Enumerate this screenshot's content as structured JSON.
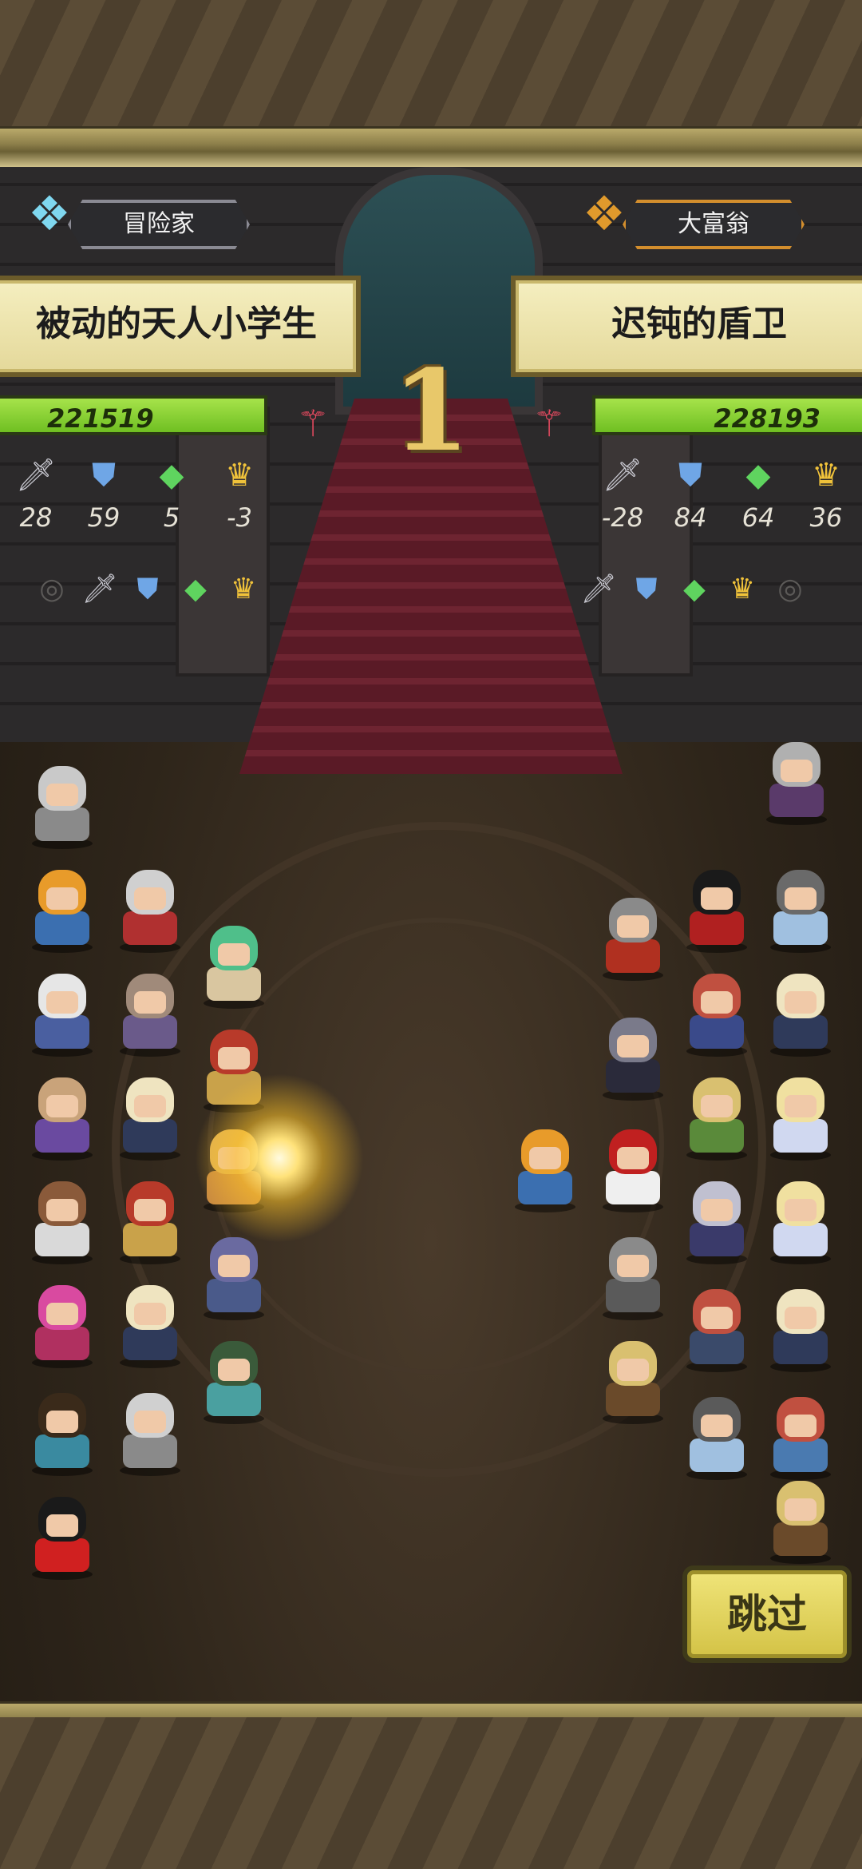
{
  "left_player": {
    "title": "冒险家",
    "name": "被动的天人小学生",
    "power": "221519",
    "stats": [
      "28",
      "59",
      "5",
      "-3"
    ]
  },
  "right_player": {
    "title": "大富翁",
    "name": "迟钝的盾卫",
    "power": "228193",
    "stats": [
      "-28",
      "84",
      "64",
      "36"
    ]
  },
  "round": "1",
  "skip_label": "跳过",
  "icons": {
    "left_badge": "wings-icon",
    "right_badge": "gold-wings-icon",
    "wand": "wand-icon",
    "sword": "sword-icon",
    "shield": "shield-icon",
    "gem": "gem-icon",
    "crown": "crown-icon"
  },
  "colors": {
    "hp_bar": "#8fd53a",
    "name_plate": "#f0e8b5",
    "skip_button": "#e6d85e"
  }
}
